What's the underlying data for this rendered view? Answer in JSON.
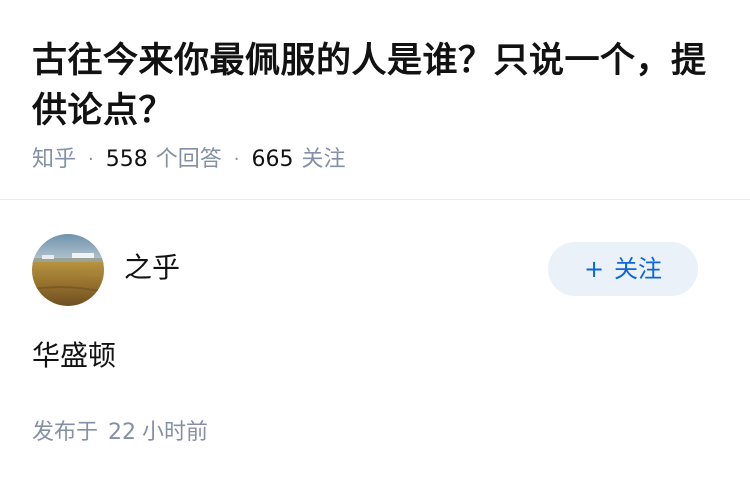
{
  "question": {
    "title": "古往今来你最佩服的人是谁？只说一个，提供论点？",
    "source": "知乎",
    "separator": "·",
    "answer_count": "558",
    "answer_count_label": "个回答",
    "follower_count": "665",
    "follower_label": "关注"
  },
  "answer": {
    "author_name": "之乎",
    "follow_button": {
      "icon": "plus-icon",
      "glyph": "+",
      "label": "关注"
    },
    "content": "华盛顿",
    "published_prefix": "发布于",
    "published_num": "22",
    "published_unit": "小时前"
  },
  "colors": {
    "accent": "#0c66d6",
    "follow_bg": "#ebf1f9",
    "meta_gray": "#8590a6",
    "title": "#121212",
    "divider": "#ebebeb"
  }
}
